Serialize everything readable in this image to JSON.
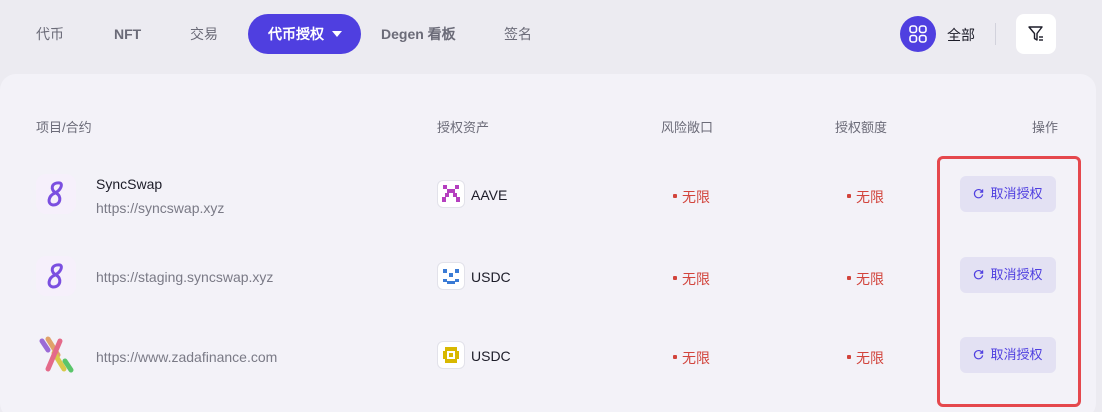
{
  "tabs": [
    {
      "label": "代币"
    },
    {
      "label": "NFT"
    },
    {
      "label": "交易"
    },
    {
      "label": "代币授权"
    },
    {
      "label": "Degen 看板"
    },
    {
      "label": "签名"
    }
  ],
  "chain_filter": {
    "label": "全部",
    "icon": "grid-icon"
  },
  "filter_icon": "filter-icon",
  "table": {
    "headers": [
      "项目/合约",
      "授权资产",
      "风险敞口",
      "授权额度",
      "操作"
    ],
    "rows": [
      {
        "project_name": "SyncSwap",
        "project_url": "https://syncswap.xyz",
        "project_icon": "syncswap-logo-icon",
        "asset": "AAVE",
        "asset_icon": "aave-token-icon",
        "risk": "无限",
        "amount": "无限",
        "action": "取消授权"
      },
      {
        "project_name": "",
        "project_url": "https://staging.syncswap.xyz",
        "project_icon": "syncswap-logo-icon",
        "asset": "USDC",
        "asset_icon": "usdc-token-icon",
        "risk": "无限",
        "amount": "无限",
        "action": "取消授权"
      },
      {
        "project_name": "",
        "project_url": "https://www.zadafinance.com",
        "project_icon": "zadafinance-logo-icon",
        "asset": "USDC",
        "asset_icon": "usdc-token-icon",
        "risk": "无限",
        "amount": "无限",
        "action": "取消授权"
      }
    ]
  },
  "colors": {
    "accent": "#4f3fe0",
    "danger": "#d2443c",
    "highlight_border": "#e5484d"
  }
}
